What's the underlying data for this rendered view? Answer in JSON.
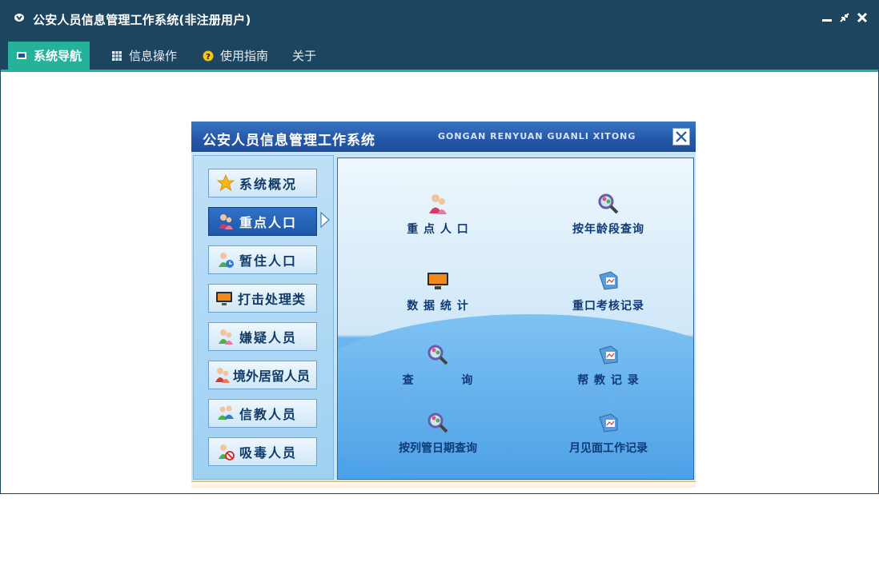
{
  "window": {
    "title": "公安人员信息管理工作系统(非注册用户)",
    "controls": [
      "minimize-icon",
      "restore-icon",
      "close-icon"
    ]
  },
  "menu": [
    {
      "label": "系统导航",
      "icon": "monitor-icon",
      "active": true
    },
    {
      "label": "信息操作",
      "icon": "grid-icon",
      "active": false
    },
    {
      "label": "使用指南",
      "icon": "help-icon",
      "active": false
    },
    {
      "label": "关于",
      "icon": "",
      "active": false
    }
  ],
  "panel": {
    "title": "公安人员信息管理工作系统",
    "subtitle": "GONGAN RENYUAN GUANLI XITONG",
    "nav": [
      {
        "label": "系统概况",
        "icon": "star-icon"
      },
      {
        "label": "重点人口",
        "icon": "users-icon",
        "active": true
      },
      {
        "label": "暂住人口",
        "icon": "users-clock-icon"
      },
      {
        "label": "打击处理类",
        "icon": "monitor-icon"
      },
      {
        "label": "嫌疑人员",
        "icon": "users-icon"
      },
      {
        "label": "境外居留人员",
        "icon": "users-icon"
      },
      {
        "label": "信教人员",
        "icon": "users-icon"
      },
      {
        "label": "吸毒人员",
        "icon": "users-block-icon"
      }
    ],
    "functions": [
      {
        "label": "重 点 人 口",
        "icon": "users-icon"
      },
      {
        "label": "按年龄段查询",
        "icon": "search-icon"
      },
      {
        "label": "数 据 统 计",
        "icon": "monitor-icon"
      },
      {
        "label": "重口考核记录",
        "icon": "document-icon"
      },
      {
        "label": "查          询",
        "icon": "search-icon"
      },
      {
        "label": "帮 教 记 录",
        "icon": "document-icon"
      },
      {
        "label": "按列管日期查询",
        "icon": "search-icon"
      },
      {
        "label": "月见面工作记录",
        "icon": "document-icon"
      }
    ]
  },
  "colors": {
    "titlebar": "#1e4560",
    "accent": "#25b29a",
    "nav_active": "#1f57a8",
    "label": "#0e3a78"
  }
}
